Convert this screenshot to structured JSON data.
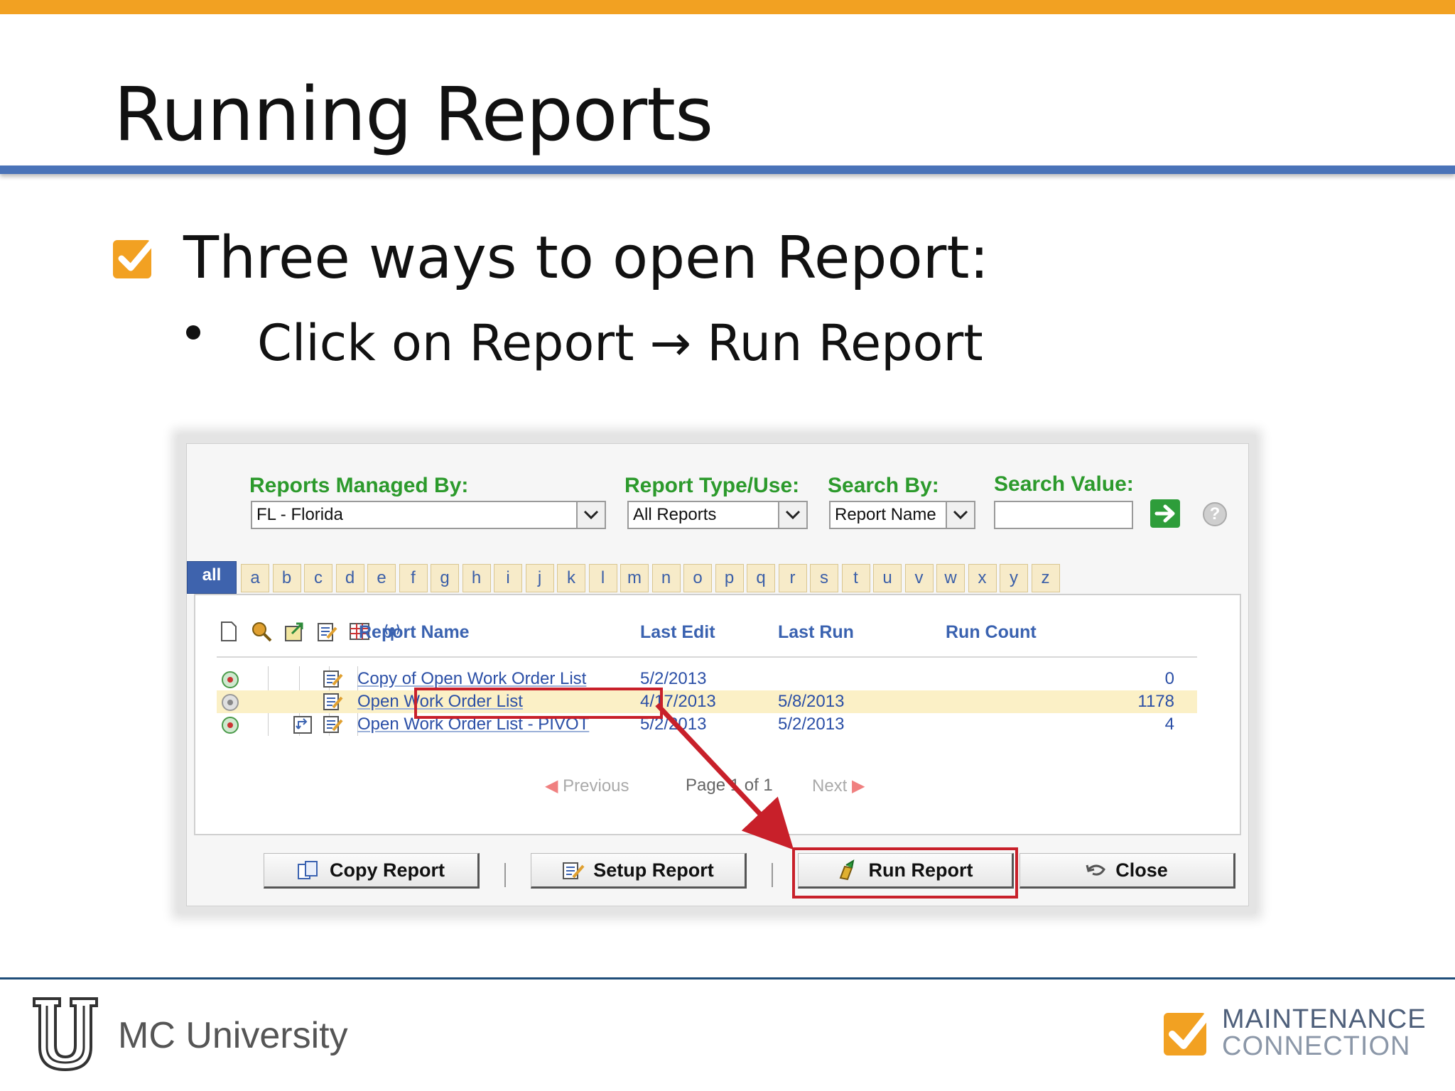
{
  "slide": {
    "title": "Running Reports",
    "bullet": "Three ways to open Report:",
    "sub_left": "Click on Report",
    "sub_arrow": "→",
    "sub_right": "Run Report"
  },
  "filters": {
    "managed_by_label": "Reports Managed By:",
    "managed_by_value": "FL - Florida",
    "type_label": "Report Type/Use:",
    "type_value": "All Reports",
    "search_by_label": "Search By:",
    "search_by_value": "Report Name",
    "search_value_label": "Search Value:",
    "search_value": ""
  },
  "tabs": [
    "all",
    "a",
    "b",
    "c",
    "d",
    "e",
    "f",
    "g",
    "h",
    "i",
    "j",
    "k",
    "l",
    "m",
    "n",
    "o",
    "p",
    "q",
    "r",
    "s",
    "t",
    "u",
    "v",
    "w",
    "x",
    "y",
    "z"
  ],
  "list": {
    "columns": {
      "name": "Report Name",
      "last_edit": "Last Edit",
      "last_run": "Last Run",
      "run_count": "Run Count"
    },
    "rows": [
      {
        "name": "Copy of Open Work Order List",
        "last_edit": "5/2/2013",
        "last_run": "",
        "run_count": "0"
      },
      {
        "name": "Open Work Order List",
        "last_edit": "4/17/2013",
        "last_run": "5/8/2013",
        "run_count": "1178"
      },
      {
        "name": "Open Work Order List - PIVOT",
        "last_edit": "5/2/2013",
        "last_run": "5/2/2013",
        "run_count": "4"
      }
    ],
    "pager": {
      "previous": "Previous",
      "page": "Page 1 of 1",
      "next": "Next"
    }
  },
  "buttons": {
    "copy": "Copy Report",
    "setup": "Setup Report",
    "run": "Run Report",
    "close": "Close"
  },
  "footer": {
    "university": "MC University",
    "brand_line1": "MAINTENANCE",
    "brand_line2": "CONNECTION"
  },
  "colors": {
    "accent_orange": "#f2a122",
    "rule_blue": "#4a73b8",
    "label_green": "#2c9a2c",
    "link_blue": "#2b4fa6",
    "highlight_red": "#c8202a",
    "row_highlight": "#fbf0c6"
  },
  "icons": [
    "check-box-icon",
    "dropdown-arrow-icon",
    "go-arrow-icon",
    "help-icon",
    "new-report-icon",
    "report-wizard-icon",
    "export-icon",
    "edit-icon",
    "calendar-grid-icon",
    "broadcast-icon",
    "status-dial-icon",
    "report-edit-icon",
    "pivot-icon",
    "copy-report-icon",
    "setup-report-icon",
    "run-report-icon",
    "close-back-icon"
  ]
}
